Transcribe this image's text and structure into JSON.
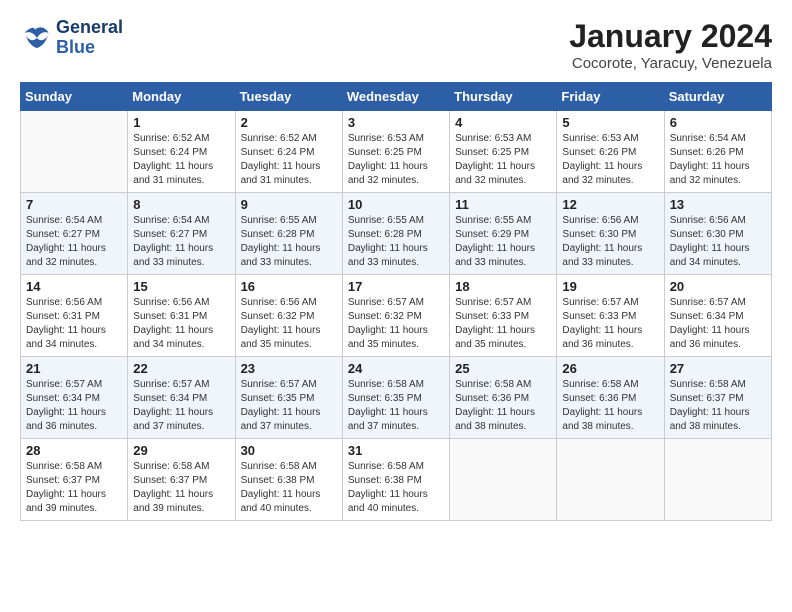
{
  "header": {
    "logo_line1": "General",
    "logo_line2": "Blue",
    "month_year": "January 2024",
    "location": "Cocorote, Yaracuy, Venezuela"
  },
  "days_of_week": [
    "Sunday",
    "Monday",
    "Tuesday",
    "Wednesday",
    "Thursday",
    "Friday",
    "Saturday"
  ],
  "weeks": [
    [
      {
        "day": "",
        "info": ""
      },
      {
        "day": "1",
        "info": "Sunrise: 6:52 AM\nSunset: 6:24 PM\nDaylight: 11 hours\nand 31 minutes."
      },
      {
        "day": "2",
        "info": "Sunrise: 6:52 AM\nSunset: 6:24 PM\nDaylight: 11 hours\nand 31 minutes."
      },
      {
        "day": "3",
        "info": "Sunrise: 6:53 AM\nSunset: 6:25 PM\nDaylight: 11 hours\nand 32 minutes."
      },
      {
        "day": "4",
        "info": "Sunrise: 6:53 AM\nSunset: 6:25 PM\nDaylight: 11 hours\nand 32 minutes."
      },
      {
        "day": "5",
        "info": "Sunrise: 6:53 AM\nSunset: 6:26 PM\nDaylight: 11 hours\nand 32 minutes."
      },
      {
        "day": "6",
        "info": "Sunrise: 6:54 AM\nSunset: 6:26 PM\nDaylight: 11 hours\nand 32 minutes."
      }
    ],
    [
      {
        "day": "7",
        "info": "Sunrise: 6:54 AM\nSunset: 6:27 PM\nDaylight: 11 hours\nand 32 minutes."
      },
      {
        "day": "8",
        "info": "Sunrise: 6:54 AM\nSunset: 6:27 PM\nDaylight: 11 hours\nand 33 minutes."
      },
      {
        "day": "9",
        "info": "Sunrise: 6:55 AM\nSunset: 6:28 PM\nDaylight: 11 hours\nand 33 minutes."
      },
      {
        "day": "10",
        "info": "Sunrise: 6:55 AM\nSunset: 6:28 PM\nDaylight: 11 hours\nand 33 minutes."
      },
      {
        "day": "11",
        "info": "Sunrise: 6:55 AM\nSunset: 6:29 PM\nDaylight: 11 hours\nand 33 minutes."
      },
      {
        "day": "12",
        "info": "Sunrise: 6:56 AM\nSunset: 6:30 PM\nDaylight: 11 hours\nand 33 minutes."
      },
      {
        "day": "13",
        "info": "Sunrise: 6:56 AM\nSunset: 6:30 PM\nDaylight: 11 hours\nand 34 minutes."
      }
    ],
    [
      {
        "day": "14",
        "info": "Sunrise: 6:56 AM\nSunset: 6:31 PM\nDaylight: 11 hours\nand 34 minutes."
      },
      {
        "day": "15",
        "info": "Sunrise: 6:56 AM\nSunset: 6:31 PM\nDaylight: 11 hours\nand 34 minutes."
      },
      {
        "day": "16",
        "info": "Sunrise: 6:56 AM\nSunset: 6:32 PM\nDaylight: 11 hours\nand 35 minutes."
      },
      {
        "day": "17",
        "info": "Sunrise: 6:57 AM\nSunset: 6:32 PM\nDaylight: 11 hours\nand 35 minutes."
      },
      {
        "day": "18",
        "info": "Sunrise: 6:57 AM\nSunset: 6:33 PM\nDaylight: 11 hours\nand 35 minutes."
      },
      {
        "day": "19",
        "info": "Sunrise: 6:57 AM\nSunset: 6:33 PM\nDaylight: 11 hours\nand 36 minutes."
      },
      {
        "day": "20",
        "info": "Sunrise: 6:57 AM\nSunset: 6:34 PM\nDaylight: 11 hours\nand 36 minutes."
      }
    ],
    [
      {
        "day": "21",
        "info": "Sunrise: 6:57 AM\nSunset: 6:34 PM\nDaylight: 11 hours\nand 36 minutes."
      },
      {
        "day": "22",
        "info": "Sunrise: 6:57 AM\nSunset: 6:34 PM\nDaylight: 11 hours\nand 37 minutes."
      },
      {
        "day": "23",
        "info": "Sunrise: 6:57 AM\nSunset: 6:35 PM\nDaylight: 11 hours\nand 37 minutes."
      },
      {
        "day": "24",
        "info": "Sunrise: 6:58 AM\nSunset: 6:35 PM\nDaylight: 11 hours\nand 37 minutes."
      },
      {
        "day": "25",
        "info": "Sunrise: 6:58 AM\nSunset: 6:36 PM\nDaylight: 11 hours\nand 38 minutes."
      },
      {
        "day": "26",
        "info": "Sunrise: 6:58 AM\nSunset: 6:36 PM\nDaylight: 11 hours\nand 38 minutes."
      },
      {
        "day": "27",
        "info": "Sunrise: 6:58 AM\nSunset: 6:37 PM\nDaylight: 11 hours\nand 38 minutes."
      }
    ],
    [
      {
        "day": "28",
        "info": "Sunrise: 6:58 AM\nSunset: 6:37 PM\nDaylight: 11 hours\nand 39 minutes."
      },
      {
        "day": "29",
        "info": "Sunrise: 6:58 AM\nSunset: 6:37 PM\nDaylight: 11 hours\nand 39 minutes."
      },
      {
        "day": "30",
        "info": "Sunrise: 6:58 AM\nSunset: 6:38 PM\nDaylight: 11 hours\nand 40 minutes."
      },
      {
        "day": "31",
        "info": "Sunrise: 6:58 AM\nSunset: 6:38 PM\nDaylight: 11 hours\nand 40 minutes."
      },
      {
        "day": "",
        "info": ""
      },
      {
        "day": "",
        "info": ""
      },
      {
        "day": "",
        "info": ""
      }
    ]
  ]
}
